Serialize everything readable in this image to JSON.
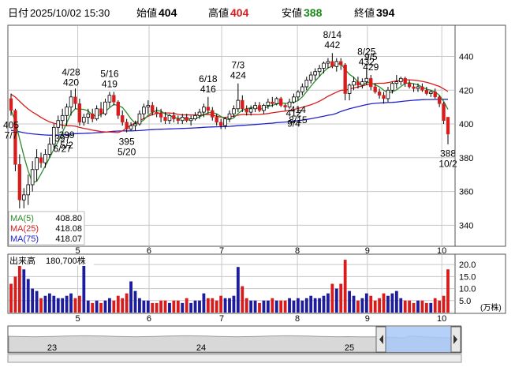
{
  "header": {
    "date_label": "日付",
    "date": "2025/10/02 15:30",
    "open_label": "始値",
    "open": "404",
    "high_label": "高値",
    "high": "404",
    "low_label": "安値",
    "low": "388",
    "close_label": "終値",
    "close": "394"
  },
  "colors": {
    "up": "#1c1c9c",
    "down": "#d81c1c",
    "ma5": "#2e8b2e",
    "ma25": "#d81c1c",
    "ma75": "#2222cc",
    "grid": "#c8c8c8",
    "frame": "#555555",
    "navfill": "#a8c8f8"
  },
  "chart_data": {
    "type": "candlestick",
    "price_axis": {
      "ticks": [
        340,
        360,
        380,
        400,
        420,
        440
      ],
      "ylim": [
        328,
        458
      ]
    },
    "x_ticks": [
      "5",
      "6",
      "7",
      "8",
      "9",
      "10"
    ],
    "volume": {
      "title": "出来高",
      "latest": "180,700株",
      "ticks": [
        "20.0",
        "15.0",
        "10.0",
        "5.0"
      ],
      "tick_values": [
        20,
        15,
        10,
        5
      ],
      "unit": "(万株)",
      "ylim": [
        0,
        24
      ]
    },
    "legend": [
      {
        "name": "MA(5)",
        "value": "408.80",
        "color": "#2e8b2e"
      },
      {
        "name": "MA(25)",
        "value": "418.08",
        "color": "#d81c1c"
      },
      {
        "name": "MA(75)",
        "value": "418.07",
        "color": "#2222cc"
      }
    ],
    "annotations": [
      {
        "date": "4/28",
        "price": "420",
        "pos": "above"
      },
      {
        "date": "5/16",
        "price": "419",
        "pos": "above"
      },
      {
        "date": "6/18",
        "price": "416",
        "pos": "above"
      },
      {
        "date": "7/3",
        "price": "424",
        "pos": "above"
      },
      {
        "date": "8/14",
        "price": "442",
        "pos": "above"
      },
      {
        "date": "8/25",
        "price": "432",
        "pos": "above"
      },
      {
        "date": "9/5",
        "price": "429",
        "pos": "above"
      },
      {
        "date": "5/2",
        "price": "399",
        "pos": "below"
      },
      {
        "date": "5/20",
        "price": "395",
        "pos": "below"
      },
      {
        "date": "6/27",
        "price": "397",
        "pos": "below"
      },
      {
        "date": "7/7",
        "price": "405",
        "pos": "below"
      },
      {
        "date": "8/15",
        "price": "414",
        "pos": "below"
      },
      {
        "date": "9/4",
        "price": "412",
        "pos": "below"
      },
      {
        "date": "10/2",
        "price": "388",
        "pos": "below"
      }
    ],
    "navigator": {
      "labels": [
        "23",
        "24",
        "25"
      ]
    },
    "candles": [
      {
        "o": 415,
        "h": 418,
        "l": 405,
        "c": 408,
        "v": 12
      },
      {
        "o": 408,
        "h": 409,
        "l": 372,
        "c": 376,
        "v": 15
      },
      {
        "o": 376,
        "h": 382,
        "l": 350,
        "c": 355,
        "v": 20
      },
      {
        "o": 355,
        "h": 362,
        "l": 350,
        "c": 358,
        "v": 18
      },
      {
        "o": 358,
        "h": 370,
        "l": 352,
        "c": 364,
        "v": 14
      },
      {
        "o": 364,
        "h": 378,
        "l": 360,
        "c": 373,
        "v": 10
      },
      {
        "o": 373,
        "h": 385,
        "l": 366,
        "c": 380,
        "v": 9
      },
      {
        "o": 380,
        "h": 383,
        "l": 374,
        "c": 377,
        "v": 6
      },
      {
        "o": 377,
        "h": 385,
        "l": 374,
        "c": 382,
        "v": 7
      },
      {
        "o": 382,
        "h": 392,
        "l": 380,
        "c": 388,
        "v": 8
      },
      {
        "o": 388,
        "h": 400,
        "l": 386,
        "c": 398,
        "v": 7
      },
      {
        "o": 398,
        "h": 405,
        "l": 394,
        "c": 402,
        "v": 6
      },
      {
        "o": 402,
        "h": 409,
        "l": 397,
        "c": 405,
        "v": 6
      },
      {
        "o": 405,
        "h": 412,
        "l": 399,
        "c": 410,
        "v": 7
      },
      {
        "o": 410,
        "h": 420,
        "l": 405,
        "c": 416,
        "v": 8
      },
      {
        "o": 416,
        "h": 421,
        "l": 409,
        "c": 412,
        "v": 6
      },
      {
        "o": 412,
        "h": 415,
        "l": 399,
        "c": 401,
        "v": 7
      },
      {
        "o": 401,
        "h": 406,
        "l": 399,
        "c": 404,
        "v": 24
      },
      {
        "o": 404,
        "h": 409,
        "l": 400,
        "c": 406,
        "v": 5
      },
      {
        "o": 406,
        "h": 409,
        "l": 401,
        "c": 403,
        "v": 4
      },
      {
        "o": 403,
        "h": 411,
        "l": 402,
        "c": 409,
        "v": 5
      },
      {
        "o": 409,
        "h": 413,
        "l": 404,
        "c": 406,
        "v": 4
      },
      {
        "o": 406,
        "h": 415,
        "l": 405,
        "c": 413,
        "v": 5
      },
      {
        "o": 413,
        "h": 419,
        "l": 410,
        "c": 417,
        "v": 6
      },
      {
        "o": 417,
        "h": 419,
        "l": 411,
        "c": 413,
        "v": 5
      },
      {
        "o": 413,
        "h": 414,
        "l": 403,
        "c": 405,
        "v": 7
      },
      {
        "o": 405,
        "h": 408,
        "l": 399,
        "c": 401,
        "v": 6
      },
      {
        "o": 401,
        "h": 403,
        "l": 395,
        "c": 397,
        "v": 8
      },
      {
        "o": 397,
        "h": 401,
        "l": 396,
        "c": 399,
        "v": 13
      },
      {
        "o": 399,
        "h": 402,
        "l": 396,
        "c": 400,
        "v": 9
      },
      {
        "o": 400,
        "h": 408,
        "l": 399,
        "c": 406,
        "v": 6
      },
      {
        "o": 406,
        "h": 412,
        "l": 403,
        "c": 410,
        "v": 5
      },
      {
        "o": 410,
        "h": 414,
        "l": 406,
        "c": 411,
        "v": 5
      },
      {
        "o": 411,
        "h": 413,
        "l": 405,
        "c": 407,
        "v": 4
      },
      {
        "o": 407,
        "h": 410,
        "l": 404,
        "c": 406,
        "v": 4
      },
      {
        "o": 406,
        "h": 409,
        "l": 401,
        "c": 404,
        "v": 5
      },
      {
        "o": 404,
        "h": 407,
        "l": 400,
        "c": 402,
        "v": 5
      },
      {
        "o": 402,
        "h": 406,
        "l": 400,
        "c": 405,
        "v": 4
      },
      {
        "o": 405,
        "h": 407,
        "l": 401,
        "c": 403,
        "v": 5
      },
      {
        "o": 403,
        "h": 405,
        "l": 400,
        "c": 402,
        "v": 5
      },
      {
        "o": 402,
        "h": 406,
        "l": 400,
        "c": 404,
        "v": 4
      },
      {
        "o": 404,
        "h": 406,
        "l": 401,
        "c": 402,
        "v": 6
      },
      {
        "o": 402,
        "h": 405,
        "l": 399,
        "c": 403,
        "v": 4
      },
      {
        "o": 403,
        "h": 407,
        "l": 402,
        "c": 405,
        "v": 5
      },
      {
        "o": 405,
        "h": 409,
        "l": 403,
        "c": 407,
        "v": 5
      },
      {
        "o": 407,
        "h": 412,
        "l": 404,
        "c": 410,
        "v": 8
      },
      {
        "o": 410,
        "h": 416,
        "l": 406,
        "c": 408,
        "v": 6
      },
      {
        "o": 408,
        "h": 410,
        "l": 402,
        "c": 404,
        "v": 6
      },
      {
        "o": 404,
        "h": 406,
        "l": 399,
        "c": 401,
        "v": 5
      },
      {
        "o": 401,
        "h": 403,
        "l": 397,
        "c": 399,
        "v": 7
      },
      {
        "o": 399,
        "h": 404,
        "l": 397,
        "c": 403,
        "v": 6
      },
      {
        "o": 403,
        "h": 408,
        "l": 401,
        "c": 406,
        "v": 6
      },
      {
        "o": 406,
        "h": 411,
        "l": 404,
        "c": 409,
        "v": 7
      },
      {
        "o": 409,
        "h": 424,
        "l": 407,
        "c": 414,
        "v": 19
      },
      {
        "o": 414,
        "h": 417,
        "l": 407,
        "c": 409,
        "v": 11
      },
      {
        "o": 409,
        "h": 411,
        "l": 405,
        "c": 407,
        "v": 6
      },
      {
        "o": 407,
        "h": 411,
        "l": 405,
        "c": 409,
        "v": 5
      },
      {
        "o": 409,
        "h": 413,
        "l": 407,
        "c": 411,
        "v": 5
      },
      {
        "o": 411,
        "h": 413,
        "l": 407,
        "c": 408,
        "v": 4
      },
      {
        "o": 408,
        "h": 412,
        "l": 406,
        "c": 411,
        "v": 5
      },
      {
        "o": 411,
        "h": 415,
        "l": 409,
        "c": 413,
        "v": 5
      },
      {
        "o": 413,
        "h": 416,
        "l": 410,
        "c": 412,
        "v": 6
      },
      {
        "o": 412,
        "h": 416,
        "l": 411,
        "c": 415,
        "v": 5
      },
      {
        "o": 415,
        "h": 416,
        "l": 410,
        "c": 411,
        "v": 5
      },
      {
        "o": 411,
        "h": 412,
        "l": 408,
        "c": 410,
        "v": 5
      },
      {
        "o": 410,
        "h": 415,
        "l": 409,
        "c": 413,
        "v": 6
      },
      {
        "o": 413,
        "h": 418,
        "l": 412,
        "c": 416,
        "v": 5
      },
      {
        "o": 416,
        "h": 420,
        "l": 414,
        "c": 419,
        "v": 6
      },
      {
        "o": 419,
        "h": 424,
        "l": 417,
        "c": 422,
        "v": 5
      },
      {
        "o": 422,
        "h": 428,
        "l": 420,
        "c": 426,
        "v": 6
      },
      {
        "o": 426,
        "h": 431,
        "l": 424,
        "c": 429,
        "v": 7
      },
      {
        "o": 429,
        "h": 433,
        "l": 426,
        "c": 431,
        "v": 6
      },
      {
        "o": 431,
        "h": 435,
        "l": 428,
        "c": 433,
        "v": 6
      },
      {
        "o": 433,
        "h": 437,
        "l": 430,
        "c": 436,
        "v": 7
      },
      {
        "o": 436,
        "h": 439,
        "l": 433,
        "c": 437,
        "v": 8
      },
      {
        "o": 437,
        "h": 442,
        "l": 433,
        "c": 434,
        "v": 12
      },
      {
        "o": 434,
        "h": 439,
        "l": 431,
        "c": 437,
        "v": 10
      },
      {
        "o": 437,
        "h": 439,
        "l": 432,
        "c": 435,
        "v": 12
      },
      {
        "o": 435,
        "h": 436,
        "l": 414,
        "c": 418,
        "v": 22
      },
      {
        "o": 418,
        "h": 424,
        "l": 414,
        "c": 423,
        "v": 9
      },
      {
        "o": 423,
        "h": 428,
        "l": 420,
        "c": 425,
        "v": 7
      },
      {
        "o": 425,
        "h": 428,
        "l": 421,
        "c": 423,
        "v": 5
      },
      {
        "o": 423,
        "h": 427,
        "l": 421,
        "c": 425,
        "v": 6
      },
      {
        "o": 425,
        "h": 432,
        "l": 423,
        "c": 427,
        "v": 8
      },
      {
        "o": 427,
        "h": 429,
        "l": 420,
        "c": 422,
        "v": 7
      },
      {
        "o": 422,
        "h": 424,
        "l": 418,
        "c": 419,
        "v": 5
      },
      {
        "o": 419,
        "h": 421,
        "l": 415,
        "c": 417,
        "v": 6
      },
      {
        "o": 417,
        "h": 419,
        "l": 412,
        "c": 415,
        "v": 8
      },
      {
        "o": 415,
        "h": 422,
        "l": 413,
        "c": 420,
        "v": 7
      },
      {
        "o": 420,
        "h": 425,
        "l": 418,
        "c": 424,
        "v": 8
      },
      {
        "o": 424,
        "h": 429,
        "l": 421,
        "c": 425,
        "v": 9
      },
      {
        "o": 425,
        "h": 428,
        "l": 423,
        "c": 427,
        "v": 6
      },
      {
        "o": 427,
        "h": 428,
        "l": 422,
        "c": 424,
        "v": 5
      },
      {
        "o": 424,
        "h": 426,
        "l": 421,
        "c": 422,
        "v": 5
      },
      {
        "o": 422,
        "h": 424,
        "l": 419,
        "c": 421,
        "v": 4
      },
      {
        "o": 421,
        "h": 424,
        "l": 419,
        "c": 422,
        "v": 5
      },
      {
        "o": 422,
        "h": 424,
        "l": 419,
        "c": 420,
        "v": 5
      },
      {
        "o": 420,
        "h": 422,
        "l": 417,
        "c": 418,
        "v": 4
      },
      {
        "o": 418,
        "h": 420,
        "l": 416,
        "c": 419,
        "v": 4
      },
      {
        "o": 419,
        "h": 421,
        "l": 415,
        "c": 416,
        "v": 6
      },
      {
        "o": 416,
        "h": 417,
        "l": 410,
        "c": 412,
        "v": 5
      },
      {
        "o": 412,
        "h": 413,
        "l": 400,
        "c": 402,
        "v": 7
      },
      {
        "o": 404,
        "h": 404,
        "l": 388,
        "c": 394,
        "v": 18
      }
    ]
  }
}
